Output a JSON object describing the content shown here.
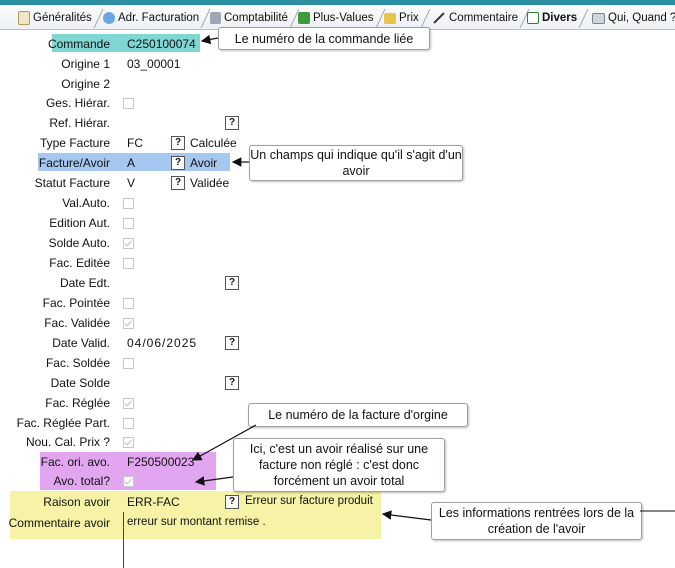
{
  "tabs": [
    {
      "label": "Généralités"
    },
    {
      "label": "Adr. Facturation"
    },
    {
      "label": "Comptabilité"
    },
    {
      "label": "Plus-Values"
    },
    {
      "label": "Prix"
    },
    {
      "label": "Commentaire"
    },
    {
      "label": "Divers"
    },
    {
      "label": "Qui, Quand ?"
    }
  ],
  "fields": {
    "commande": {
      "label": "Commande",
      "value": "C250100074"
    },
    "origine1": {
      "label": "Origine 1",
      "value": "03_00001"
    },
    "origine2": {
      "label": "Origine 2"
    },
    "ges_hierar": {
      "label": "Ges. Hiérar."
    },
    "ref_hierar": {
      "label": "Ref. Hiérar.",
      "button": "?"
    },
    "type_facture": {
      "label": "Type Facture",
      "value": "FC",
      "button": "?",
      "desc": "Calculée"
    },
    "facture_avoir": {
      "label": "Facture/Avoir",
      "value": "A",
      "button": "?",
      "desc": "Avoir"
    },
    "statut_facture": {
      "label": "Statut Facture",
      "value": "V",
      "button": "?",
      "desc": "Validée"
    },
    "val_auto": {
      "label": "Val.Auto."
    },
    "edition_aut": {
      "label": "Edition Aut."
    },
    "solde_auto": {
      "label": "Solde Auto."
    },
    "fac_editee": {
      "label": "Fac. Editée"
    },
    "date_edt": {
      "label": "Date Edt.",
      "button": "?"
    },
    "fac_pointee": {
      "label": "Fac. Pointée"
    },
    "fac_validee": {
      "label": "Fac. Validée"
    },
    "date_valid": {
      "label": "Date Valid.",
      "value": "04/06/2025",
      "button": "?"
    },
    "fac_soldee": {
      "label": "Fac. Soldée"
    },
    "date_solde": {
      "label": "Date Solde",
      "button": "?"
    },
    "fac_reglee": {
      "label": "Fac. Réglée"
    },
    "fac_reglee_part": {
      "label": "Fac. Réglée Part."
    },
    "nou_cal_prix": {
      "label": "Nou. Cal. Prix ?"
    },
    "fac_ori_avo": {
      "label": "Fac. ori. avo.",
      "value": "F250500023"
    },
    "avo_total": {
      "label": "Avo. total?"
    },
    "raison_avoir": {
      "label": "Raison avoir",
      "value": "ERR-FAC",
      "button": "?",
      "desc": "Erreur sur facture produit"
    },
    "commentaire_avoir": {
      "label": "Commentaire avoir",
      "value": "erreur sur montant remise ."
    }
  },
  "callouts": {
    "commande": "Le numéro de la commande liée",
    "facture_avoir": "Un champs qui indique qu'il s'agit d'un avoir",
    "fac_ori": "Le numéro de la facture d'orgine",
    "avo_total": "Ici, c'est un avoir réalisé sur une facture non réglé : c'est donc forcément un avoir total",
    "informations": "Les informations rentrées lors de la création de l'avoir"
  },
  "colors": {
    "teal_highlight": "#7fd6d2",
    "blue_highlight": "#a6c8f0",
    "purple_highlight": "#e2a6f0",
    "yellow_highlight": "#f7f3a6",
    "top_bar": "#2a8ea0"
  },
  "checkboxes": {
    "ges_hierar": false,
    "val_auto": false,
    "edition_aut": false,
    "solde_auto": true,
    "fac_editee": false,
    "fac_pointee": false,
    "fac_validee": true,
    "fac_soldee": false,
    "fac_reglee": true,
    "fac_reglee_part": false,
    "nou_cal_prix": true,
    "avo_total": true
  }
}
